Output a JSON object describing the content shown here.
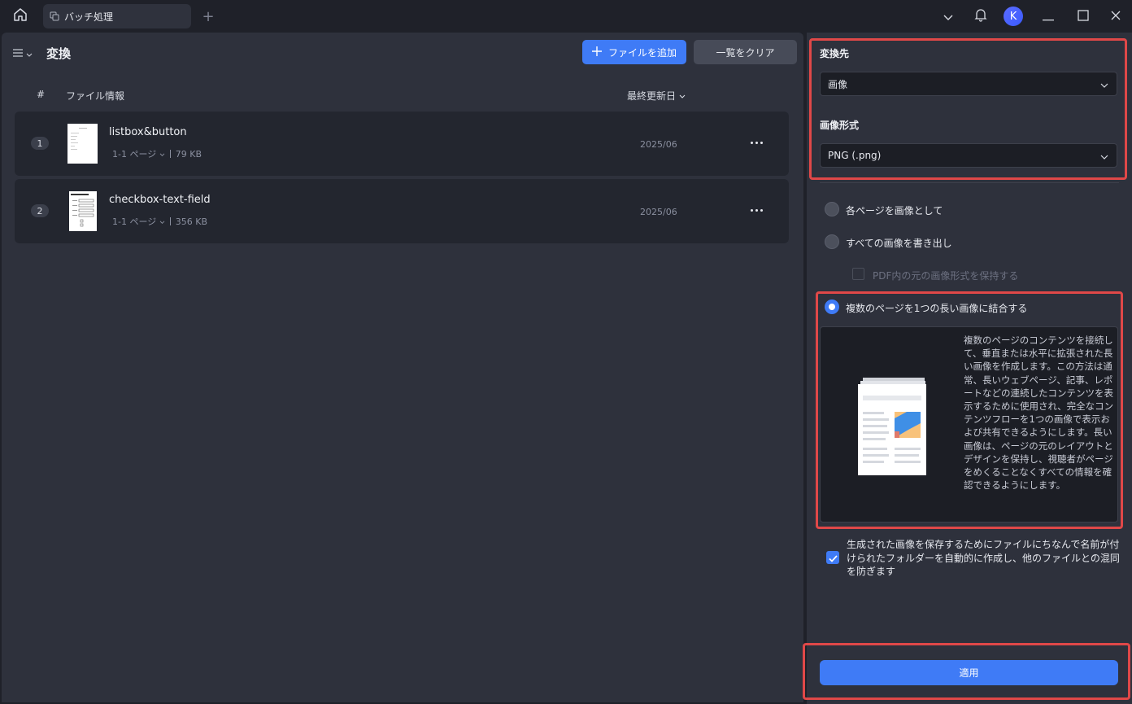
{
  "titlebar": {
    "tab_label": "バッチ処理",
    "avatar_letter": "K"
  },
  "left": {
    "title": "変換",
    "add_files_label": "ファイルを追加",
    "clear_list_label": "一覧をクリア",
    "columns": {
      "index": "#",
      "file_info": "ファイル情報",
      "modified": "最終更新日"
    },
    "files": [
      {
        "index": "1",
        "name": "listbox&button",
        "pages": "1-1 ページ",
        "size": "79 KB",
        "date": "2025/06"
      },
      {
        "index": "2",
        "name": "checkbox-text-field",
        "pages": "1-1 ページ",
        "size": "356 KB",
        "date": "2025/06"
      }
    ]
  },
  "right": {
    "target_label": "変換先",
    "target_value": "画像",
    "format_label": "画像形式",
    "format_value": "PNG (.png)",
    "options": {
      "each_page": "各ページを画像として",
      "export_all": "すべての画像を書き出し",
      "keep_format": "PDF内の元の画像形式を保持する",
      "combine": "複数のページを1つの長い画像に結合する"
    },
    "combine_description": "複数のページのコンテンツを接続して、垂直または水平に拡張された長い画像を作成します。この方法は通常、長いウェブページ、記事、レポートなどの連続したコンテンツを表示するために使用され、完全なコンテンツフローを1つの画像で表示および共有できるようにします。長い画像は、ページの元のレイアウトとデザインを保持し、視聴者がページをめくることなくすべての情報を確認できるようにします。",
    "folder_option": "生成された画像を保存するためにファイルにちなんで名前が付けられたフォルダーを自動的に作成し、他のファイルとの混同を防ぎます",
    "apply_label": "適用"
  },
  "colors": {
    "accent": "#3f7bf6",
    "highlight_border": "#e04848"
  }
}
